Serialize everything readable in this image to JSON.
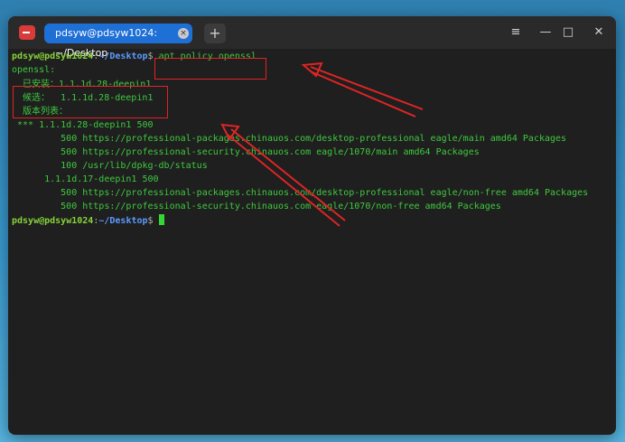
{
  "titlebar": {
    "tab_title": "pdsyw@pdsyw1024: ~/Desktop",
    "tab_close": "×",
    "new_tab": "+",
    "menu": "≡",
    "minimize": "—",
    "maximize": "□",
    "close": "✕"
  },
  "prompt": {
    "user": "pdsyw@pdsyw1024",
    "sep": ":",
    "path": "~/Desktop",
    "symbol": "$"
  },
  "command": "apt policy openssl",
  "output": {
    "package": "openssl:",
    "installed": "已安装：1.1.1d.28-deepin1",
    "candidate": "候选：  1.1.1d.28-deepin1",
    "version_table": "版本列表：",
    "lines": [
      "*** 1.1.1d.28-deepin1 500",
      "        500 https://professional-packages.chinauos.com/desktop-professional eagle/main amd64 Packages",
      "        500 https://professional-security.chinauos.com eagle/1070/main amd64 Packages",
      "        100 /usr/lib/dpkg-db/status",
      "     1.1.1d.17-deepin1 500",
      "        500 https://professional-packages.chinauos.com/desktop-professional eagle/non-free amd64 Packages",
      "        500 https://professional-security.chinauos.com eagle/1070/non-free amd64 Packages"
    ]
  },
  "colors": {
    "annotation": "#e02424",
    "terminal_text": "#3ec93e",
    "tab_active": "#1e6fd6"
  }
}
